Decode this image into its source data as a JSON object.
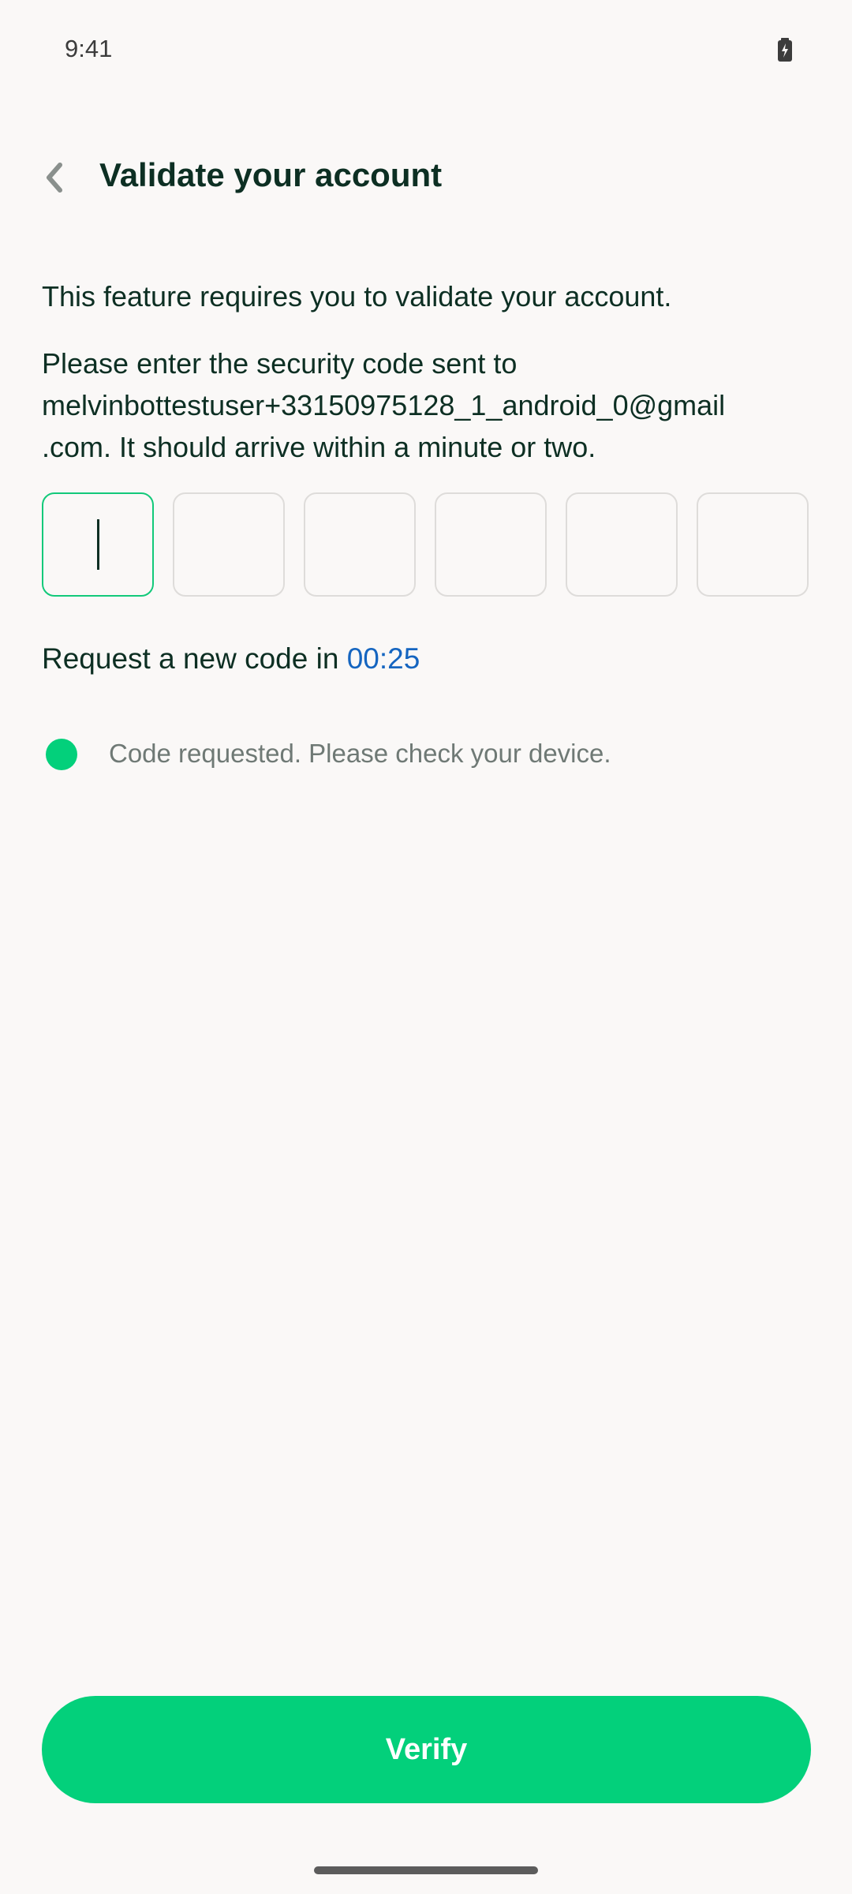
{
  "status_bar": {
    "time": "9:41",
    "battery_icon": "battery-charging-icon"
  },
  "header": {
    "back_icon": "chevron-left-icon",
    "title": "Validate your account"
  },
  "content": {
    "intro": "This feature requires you to validate your account.",
    "instructions": "Please enter the security code sent to melvinbottestuser+33150975128_1_android_0@gmail.com. It should arrive within a minute or two.",
    "code_length": 6,
    "code_values": [
      "",
      "",
      "",
      "",
      "",
      ""
    ],
    "timer_label": "Request a new code in",
    "timer_value": "00:25",
    "status_message": "Code requested. Please check your device."
  },
  "footer": {
    "verify_label": "Verify"
  },
  "colors": {
    "accent_green": "#03d07b",
    "active_border": "#12c97a",
    "timer_blue": "#1565c0",
    "text_dark": "#0d2f23",
    "background": "#faf8f7"
  }
}
